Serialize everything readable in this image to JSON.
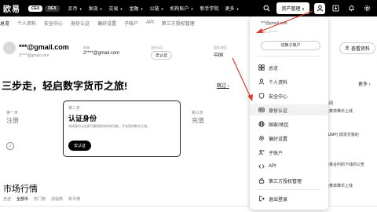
{
  "nav": {
    "logo": "欧易",
    "pill_cex": "CEX",
    "pill_dex": "DEX",
    "items": [
      "买币",
      "发现",
      "交易",
      "金融",
      "公链",
      "机构账户",
      "新手学院",
      "更多"
    ],
    "assets_button": "资产管理"
  },
  "subtabs": [
    "总览",
    "个人资料",
    "安全中心",
    "身份认证",
    "偏好设置",
    "子账户",
    "API",
    "第三方授权管理"
  ],
  "profile": {
    "email": "***@gmail.com",
    "email_sub": "2****@gmail.com",
    "account_label": "邮箱",
    "account_value": "2****@gmail.com",
    "verify_label": "身份认证",
    "verify_button": "去认证",
    "country_label": "国家/地区",
    "country_value": "中国",
    "view_button": "查看资料"
  },
  "headline": "三步走，轻启数字货币之旅!",
  "more_link": "更多",
  "skip_link": "跳过",
  "steps": {
    "s1_label": "第一步",
    "s1_name": "注册",
    "s2_label": "第二步",
    "s2_title": "认证身份",
    "s2_desc": "完成身份认证即可解锁您的所有功能，开启您的数字之旅。",
    "s2_button": "去认证",
    "s3_label": "第三步",
    "s3_name": "充值"
  },
  "right_snippets": [
    "新闻",
    "及菜单降币上线",
    "RUMP) 现货交易的",
    "交易合约的下线的公告",
    "及菜单降币上线"
  ],
  "market": {
    "title": "市场行情",
    "tabs": [
      "自选",
      "全部币",
      "热门榜",
      "涨幅榜",
      "新币榜"
    ]
  },
  "dropdown": {
    "email": "***@gmail.com",
    "uid": "UID: 2*******",
    "switch_button": "切换子账户",
    "items": [
      {
        "label": "总览",
        "icon": "grid-icon"
      },
      {
        "label": "个人资料",
        "icon": "user-icon"
      },
      {
        "label": "安全中心",
        "icon": "shield-icon"
      },
      {
        "label": "身份认证",
        "icon": "id-card-icon"
      },
      {
        "label": "国家/地区",
        "icon": "globe-icon"
      },
      {
        "label": "偏好设置",
        "icon": "settings-icon"
      },
      {
        "label": "子账户",
        "icon": "sub-account-icon"
      },
      {
        "label": "API",
        "icon": "api-icon"
      },
      {
        "label": "第三方授权管理",
        "icon": "authorization-icon"
      }
    ],
    "logout": "退出登录"
  },
  "colors": {
    "nav_bg": "#000000",
    "accent": "#000000",
    "arrow": "#e03a2f",
    "highlight": "#f2f2f2"
  }
}
